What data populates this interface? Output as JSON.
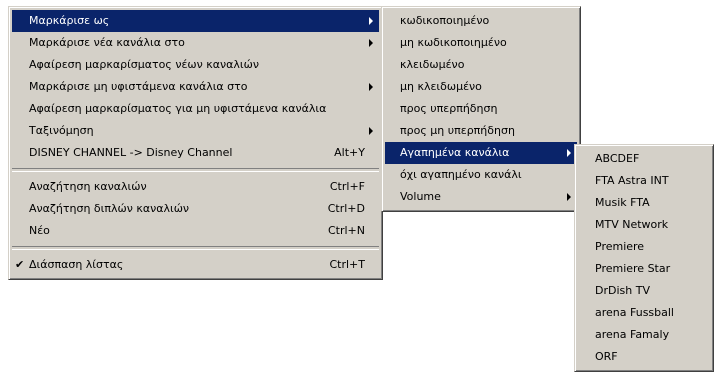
{
  "menu_main": {
    "items": [
      {
        "label": "Μαρκάρισε ως",
        "shortcut": "",
        "submenu": true,
        "selected": true
      },
      {
        "label": "Μαρκάρισε νέα κανάλια στο",
        "shortcut": "",
        "submenu": true
      },
      {
        "label": "Αφαίρεση μαρκαρίσματος νέων καναλιών",
        "shortcut": "",
        "submenu": false
      },
      {
        "label": "Μαρκάρισε μη υφιστάμενα κανάλια στο",
        "shortcut": "",
        "submenu": true
      },
      {
        "label": "Αφαίρεση μαρκαρίσματος για μη υφιστάμενα κανάλια",
        "shortcut": "",
        "submenu": false
      },
      {
        "label": "Ταξινόμηση",
        "shortcut": "",
        "submenu": true
      },
      {
        "label": "DISNEY CHANNEL -> Disney Channel",
        "shortcut": "Alt+Y",
        "submenu": false
      },
      {
        "label": "Αναζήτηση καναλιών",
        "shortcut": "Ctrl+F",
        "submenu": false
      },
      {
        "label": "Αναζήτηση διπλών καναλιών",
        "shortcut": "Ctrl+D",
        "submenu": false
      },
      {
        "label": "Νέο",
        "shortcut": "Ctrl+N",
        "submenu": false
      },
      {
        "label": "Διάσπαση λίστας",
        "shortcut": "Ctrl+T",
        "submenu": false,
        "checked": true,
        "check_glyph": "✔"
      }
    ]
  },
  "menu_mark_as": {
    "items": [
      {
        "label": "κωδικοποιημένο"
      },
      {
        "label": "μη κωδικοποιημένο"
      },
      {
        "label": "κλειδωμένο"
      },
      {
        "label": "μη κλειδωμένο"
      },
      {
        "label": "προς υπερπήδηση"
      },
      {
        "label": "προς μη υπερπήδηση"
      },
      {
        "label": "Αγαπημένα κανάλια",
        "submenu": true,
        "selected": true
      },
      {
        "label": "όχι αγαπημένο κανάλι"
      },
      {
        "label": "Volume",
        "submenu": true
      }
    ]
  },
  "menu_favorites": {
    "items": [
      {
        "label": "ABCDEF"
      },
      {
        "label": "FTA Astra INT"
      },
      {
        "label": "Musik FTA"
      },
      {
        "label": "MTV Network"
      },
      {
        "label": "Premiere"
      },
      {
        "label": "Premiere Star"
      },
      {
        "label": "DrDish TV"
      },
      {
        "label": "arena Fussball"
      },
      {
        "label": "arena Famaly"
      },
      {
        "label": "ORF"
      }
    ]
  },
  "colors": {
    "menu_bg": "#d4d0c8",
    "highlight": "#0a246a",
    "highlight_text": "#ffffff"
  }
}
